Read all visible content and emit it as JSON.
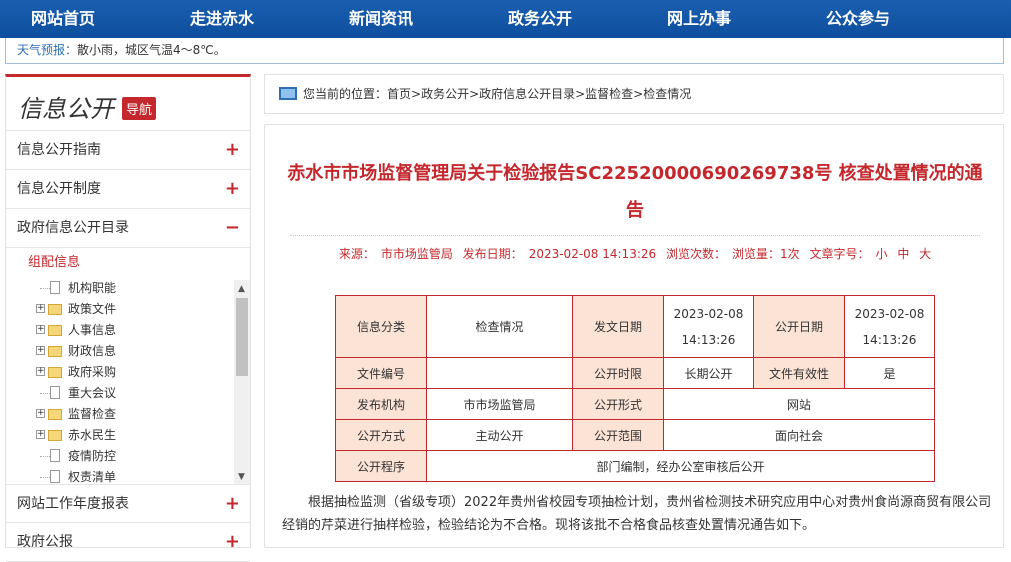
{
  "nav": {
    "items": [
      "网站首页",
      "走进赤水",
      "新闻资讯",
      "政务公开",
      "网上办事",
      "公众参与"
    ]
  },
  "weather": {
    "label": "天气预报：",
    "text": "散小雨，城区气温4～8℃。"
  },
  "sidebar": {
    "title": "信息公开",
    "badge": "导航",
    "items_top": [
      {
        "label": "信息公开指南",
        "sign": "+"
      },
      {
        "label": "信息公开制度",
        "sign": "+"
      },
      {
        "label": "政府信息公开目录",
        "sign": "−"
      }
    ],
    "sub_head": "组配信息",
    "tree": [
      {
        "label": "机构职能",
        "kind": "doc"
      },
      {
        "label": "政策文件",
        "kind": "folder"
      },
      {
        "label": "人事信息",
        "kind": "folder"
      },
      {
        "label": "财政信息",
        "kind": "folder"
      },
      {
        "label": "政府采购",
        "kind": "folder"
      },
      {
        "label": "重大会议",
        "kind": "doc"
      },
      {
        "label": "监督检查",
        "kind": "folder"
      },
      {
        "label": "赤水民生",
        "kind": "folder"
      },
      {
        "label": "疫情防控",
        "kind": "doc"
      },
      {
        "label": "权责清单",
        "kind": "doc"
      }
    ],
    "items_bottom": [
      {
        "label": "网站工作年度报表",
        "sign": "+"
      },
      {
        "label": "政府公报",
        "sign": "+"
      }
    ]
  },
  "breadcrumb": {
    "prefix": "您当前的位置：",
    "path": "首页>政务公开>政府信息公开目录>监督检查>检查情况"
  },
  "article": {
    "title": "赤水市市场监督管理局关于检验报告SC22520000690269738号 核查处置情况的通告",
    "meta": {
      "source_label": "来源：",
      "source": "市市场监管局",
      "date_label": "发布日期：",
      "date": "2023-02-08 14:13:26",
      "views_label": "浏览次数：",
      "views": "浏览量：1次",
      "font_label": "文章字号：",
      "font_small": "小",
      "font_mid": "中",
      "font_big": "大"
    },
    "table": {
      "r1": [
        "信息分类",
        "检查情况",
        "发文日期",
        "2023-02-08",
        "14:13:26",
        "公开日期",
        "2023-02-08",
        "14:13:26"
      ],
      "r2": [
        "文件编号",
        "",
        "公开时限",
        "长期公开",
        "文件有效性",
        "是"
      ],
      "r3": [
        "发布机构",
        "市市场监管局",
        "公开形式",
        "网站"
      ],
      "r4": [
        "公开方式",
        "主动公开",
        "公开范围",
        "面向社会"
      ],
      "r5": [
        "公开程序",
        "部门编制，经办公室审核后公开"
      ]
    },
    "paragraph": "根据抽检监测（省级专项）2022年贵州省校园专项抽检计划，贵州省检测技术研究应用中心对贵州食尚源商贸有限公司经销的芹菜进行抽样检验，检验结论为不合格。现将该批不合格食品核查处置情况通告如下。"
  },
  "colors": {
    "nav_blue": "#0f4e9e",
    "accent_red": "#c4282d",
    "label_bg": "#fbe3d6"
  }
}
